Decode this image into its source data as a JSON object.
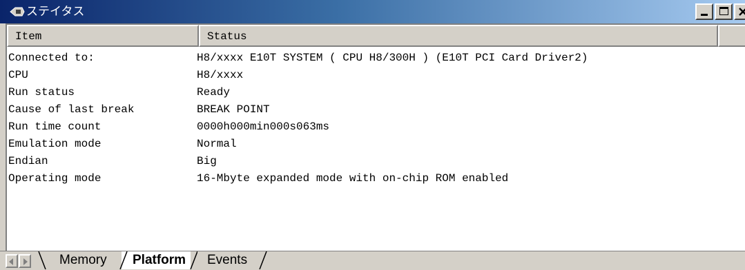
{
  "window": {
    "title": "ステイタス",
    "icon": "cpu-chip-icon"
  },
  "title_buttons": {
    "minimize": "minimize-icon",
    "maximize": "maximize-icon",
    "close": "close-icon"
  },
  "table": {
    "columns": [
      "Item",
      "Status"
    ],
    "rows": [
      {
        "item": "Connected to:",
        "status": "H8/xxxx E10T SYSTEM ( CPU H8/300H ) (E10T PCI Card Driver2)"
      },
      {
        "item": "CPU",
        "status": "H8/xxxx"
      },
      {
        "item": "Run status",
        "status": "Ready"
      },
      {
        "item": "Cause of last break",
        "status": "BREAK POINT"
      },
      {
        "item": "Run time count",
        "status": "0000h000min000s063ms"
      },
      {
        "item": "Emulation mode",
        "status": "Normal"
      },
      {
        "item": "Endian",
        "status": "Big"
      },
      {
        "item": "Operating mode",
        "status": "16-Mbyte expanded mode with on-chip ROM enabled"
      }
    ]
  },
  "tabs": [
    {
      "label": "Memory",
      "selected": false
    },
    {
      "label": "Platform",
      "selected": true
    },
    {
      "label": "Events",
      "selected": false
    }
  ],
  "colors": {
    "titlebar_start": "#0a246a",
    "titlebar_end": "#a6caf0",
    "face": "#d4d0c8"
  }
}
